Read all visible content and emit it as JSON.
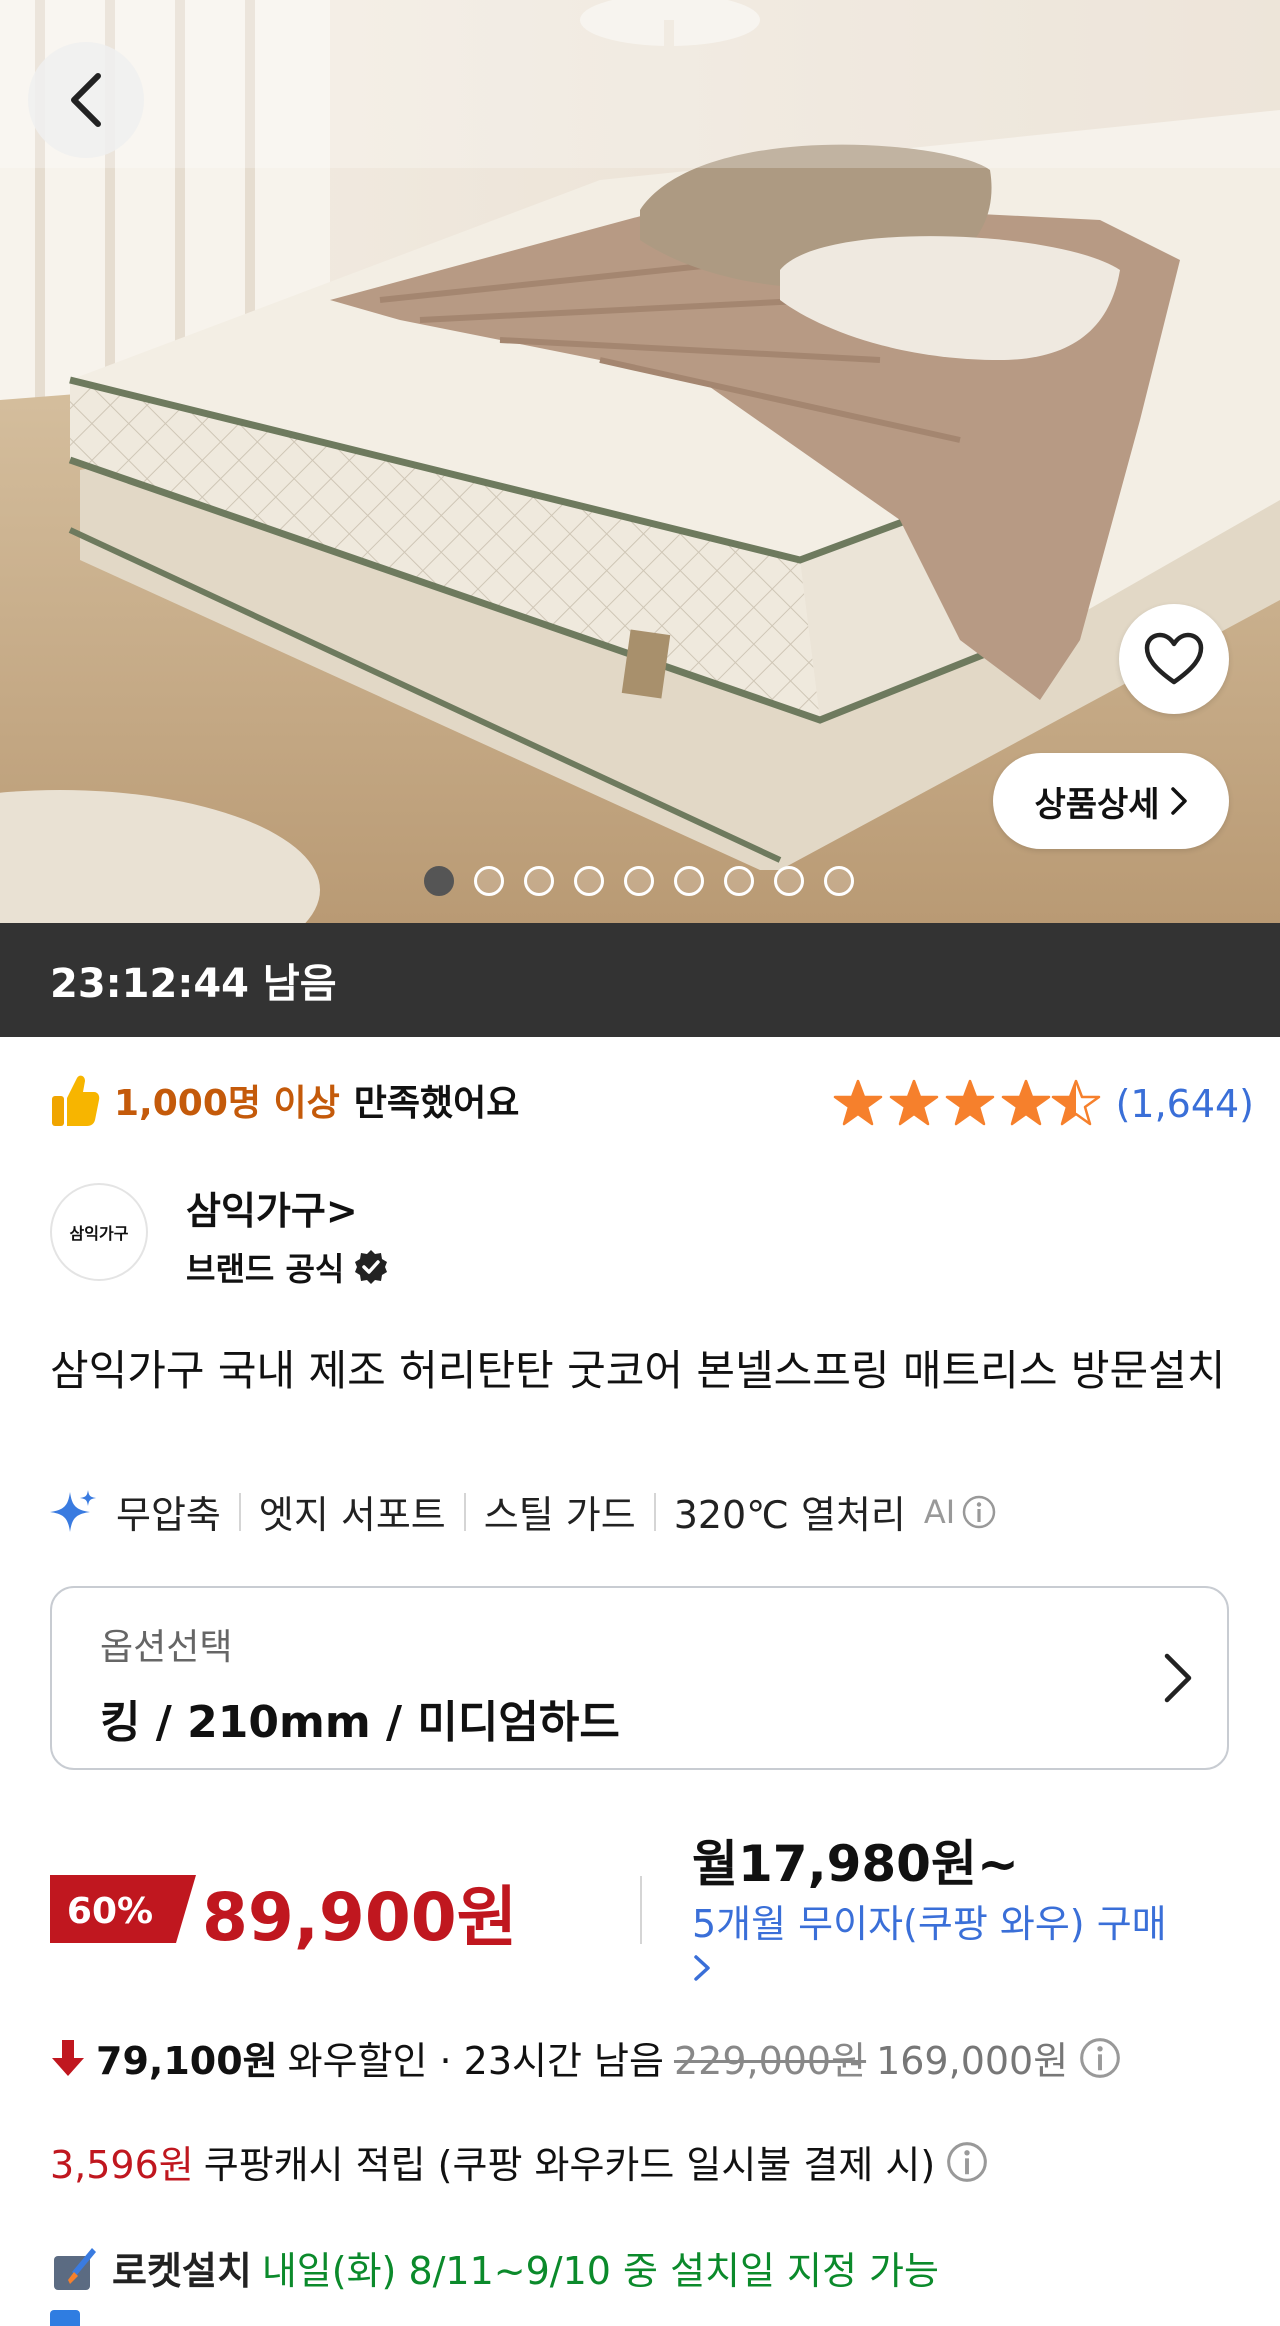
{
  "header": {
    "back_icon": "chevron-left-icon"
  },
  "hero": {
    "detail_button_label": "상품상세",
    "image_count": 9,
    "active_image_index": 0
  },
  "timer": {
    "text": "23:12:44 남음"
  },
  "satisfaction": {
    "highlight": "1,000명 이상",
    "suffix": "만족했어요",
    "rating_stars": 4.5,
    "review_count": "(1,644)"
  },
  "seller": {
    "logo_text": "삼익가구",
    "name": "삼익가구>",
    "badge": "브랜드 공식"
  },
  "product": {
    "title": "삼익가구 국내 제조 허리탄탄 굿코어 본넬스프링 매트리스 방문설치",
    "tags": [
      "무압축",
      "엣지 서포트",
      "스틸 가드",
      "320℃ 열처리"
    ],
    "ai_label": "AI"
  },
  "option": {
    "label": "옵션선택",
    "value": "킹 / 210mm / 미디엄하드"
  },
  "price": {
    "discount_rate": "60%",
    "sale_price": "89,900원",
    "monthly": "월17,980원~",
    "installment": "5개월 무이자(쿠팡 와우) 구매"
  },
  "wow": {
    "discount_amount": "79,100원",
    "text": "와우할인 · 23시간 남음",
    "list_price": "229,000원",
    "price_before": "169,000원"
  },
  "cash": {
    "amount": "3,596원",
    "text": "쿠팡캐시 적립 (쿠팡 와우카드 일시불 결제 시)"
  },
  "rocket": {
    "name": "로켓설치",
    "desc": "내일(화) 8/11~9/10 중 설치일 지정 가능"
  },
  "colors": {
    "accent_red": "#c0171f",
    "link_blue": "#3a6fd8",
    "star_orange": "#f6802c",
    "rocket_green": "#0b8a2b"
  }
}
